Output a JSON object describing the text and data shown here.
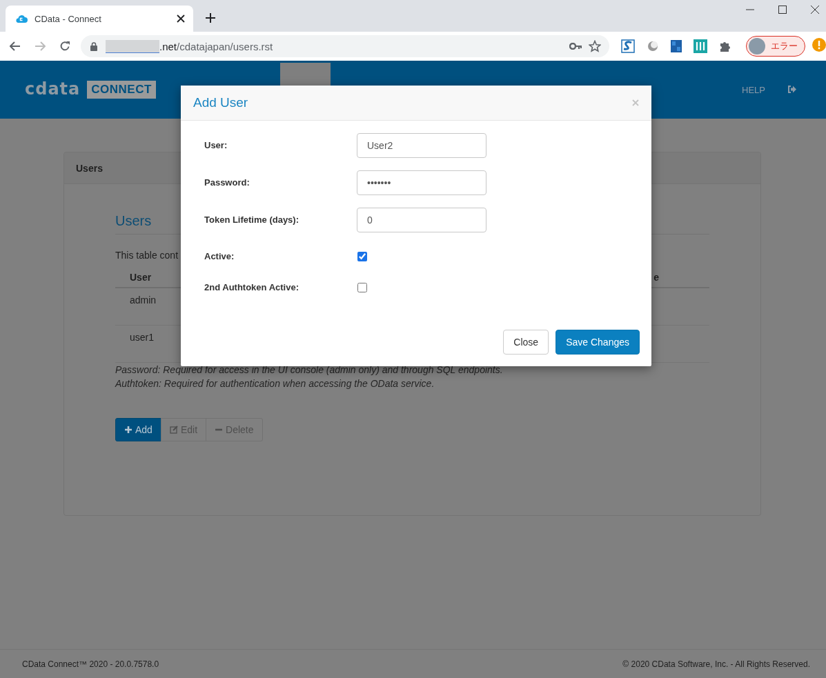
{
  "browser": {
    "tab": {
      "title": "CData - Connect"
    },
    "url": {
      "host": ".net",
      "path": "/cdatajapan/users.rst"
    },
    "profile": {
      "status": "エラー"
    }
  },
  "header": {
    "logo": {
      "wordmark": "cdata",
      "product": "CONNECT"
    },
    "nav": [
      "HELP"
    ]
  },
  "panel": {
    "title": "Users",
    "heading": "Users",
    "intro": "This table cont",
    "table": {
      "columns": [
        "User",
        "e"
      ],
      "rows": [
        [
          "admin"
        ],
        [
          "user1"
        ]
      ]
    },
    "notes": [
      "Password: Required for access in the UI console (admin only) and through SQL endpoints.",
      "Authtoken: Required for authentication when accessing the OData service."
    ],
    "actions": [
      {
        "kind": "add",
        "label": "Add"
      },
      {
        "kind": "edit",
        "label": "Edit"
      },
      {
        "kind": "delete",
        "label": "Delete"
      }
    ]
  },
  "modal": {
    "title": "Add User",
    "fields": [
      {
        "kind": "text",
        "label": "User:",
        "value": "User2"
      },
      {
        "kind": "text",
        "label": "Password:",
        "value": "•••••••"
      },
      {
        "kind": "text",
        "label": "Token Lifetime (days):",
        "value": "0"
      },
      {
        "kind": "checkbox",
        "label": "Active:",
        "checked": true
      },
      {
        "kind": "checkbox",
        "label": "2nd Authtoken Active:",
        "checked": false
      }
    ],
    "buttons": [
      {
        "kind": "secondary",
        "label": "Close"
      },
      {
        "kind": "primary",
        "label": "Save Changes"
      }
    ]
  },
  "footer": {
    "version": "CData Connect™ 2020 - 20.0.7578.0",
    "copyright": "© 2020 CData Software, Inc. - All Rights Reserved."
  }
}
